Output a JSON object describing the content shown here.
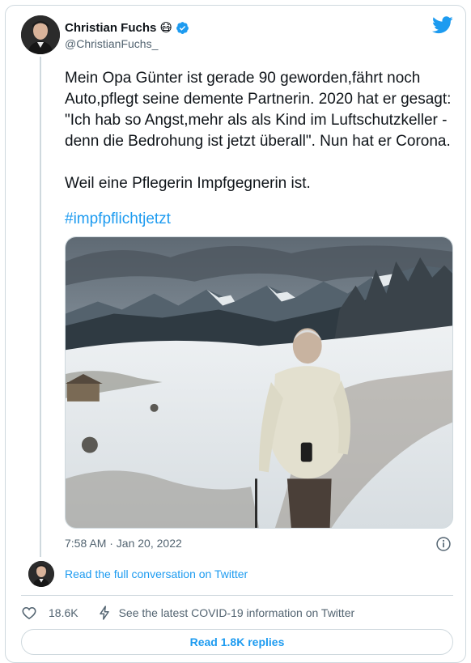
{
  "author": {
    "name": "Christian Fuchs",
    "name_emoji": "😷",
    "handle": "@ChristianFuchs_",
    "avatar_icon": "user-avatar"
  },
  "tweet": {
    "text": "Mein Opa Günter ist gerade 90 geworden,fährt noch Auto,pflegt seine demente Partnerin. 2020 hat er gesagt: \"Ich hab so Angst,mehr als als Kind im Luftschutzkeller - denn die Bedrohung ist jetzt überall\". Nun hat er Corona.\n\nWeil eine Pflegerin Impfgegnerin ist.",
    "hashtag": "#impfpflichtjetzt",
    "timestamp": "7:58 AM · Jan 20, 2022"
  },
  "footer": {
    "read_conversation": "Read the full conversation on Twitter",
    "likes": "18.6K",
    "covid_info": "See the latest COVID-19 information on Twitter",
    "replies_button": "Read 1.8K replies"
  },
  "colors": {
    "accent": "#1d9bf0",
    "text": "#0f1419",
    "secondary": "#536471",
    "border": "#cfd9de"
  },
  "icons": [
    "twitter-bird-icon",
    "verified-badge-icon",
    "info-icon",
    "heart-icon",
    "bolt-icon"
  ]
}
